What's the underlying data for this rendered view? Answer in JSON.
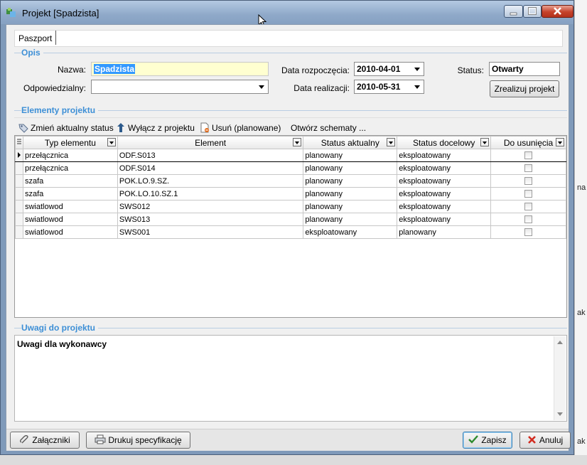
{
  "window": {
    "title": "Projekt [Spadzista]"
  },
  "tabs": [
    {
      "label": "Paszport"
    }
  ],
  "opis": {
    "section_label": "Opis",
    "nazwa_label": "Nazwa:",
    "nazwa_value": "Spadzista",
    "odpowiedzialny_label": "Odpowiedzialny:",
    "odpowiedzialny_value": "",
    "data_rozpoczecia_label": "Data rozpoczęcia:",
    "data_rozpoczecia_value": "2010-04-01",
    "data_realizacji_label": "Data realizacji:",
    "data_realizacji_value": "2010-05-31",
    "status_label": "Status:",
    "status_value": "Otwarty",
    "zrealizuj_button": "Zrealizuj projekt"
  },
  "elementy": {
    "section_label": "Elementy projektu",
    "toolbar": {
      "zmien": "Zmień aktualny status",
      "wylacz": "Wyłącz z projektu",
      "usun": "Usuń (planowane)",
      "otworz": "Otwórz schematy ..."
    },
    "columns": [
      "Typ elementu",
      "Element",
      "Status aktualny",
      "Status docelowy",
      "Do usunięcia"
    ],
    "rows": [
      {
        "typ": "przełącznica",
        "element": "ODF.S013",
        "status_aktualny": "planowany",
        "status_docelowy": "eksploatowany",
        "do_usuniecia": false
      },
      {
        "typ": "przełącznica",
        "element": "ODF.S014",
        "status_aktualny": "planowany",
        "status_docelowy": "eksploatowany",
        "do_usuniecia": false
      },
      {
        "typ": "szafa",
        "element": "POK.LO.9.SZ.",
        "status_aktualny": "planowany",
        "status_docelowy": "eksploatowany",
        "do_usuniecia": false
      },
      {
        "typ": "szafa",
        "element": "POK.LO.10.SZ.1",
        "status_aktualny": "planowany",
        "status_docelowy": "eksploatowany",
        "do_usuniecia": false
      },
      {
        "typ": "swiatlowod",
        "element": "SWS012",
        "status_aktualny": "planowany",
        "status_docelowy": "eksploatowany",
        "do_usuniecia": false
      },
      {
        "typ": "swiatlowod",
        "element": "SWS013",
        "status_aktualny": "planowany",
        "status_docelowy": "eksploatowany",
        "do_usuniecia": false
      },
      {
        "typ": "swiatlowod",
        "element": "SWS001",
        "status_aktualny": "eksploatowany",
        "status_docelowy": "planowany",
        "do_usuniecia": false
      }
    ]
  },
  "uwagi": {
    "section_label": "Uwagi do projektu",
    "text": "Uwagi dla wykonawcy"
  },
  "footer": {
    "zalaczniki": "Załączniki",
    "drukuj": "Drukuj specyfikację",
    "zapisz": "Zapisz",
    "anuluj": "Anuluj"
  },
  "background_fragments": [
    "na",
    "ak",
    "ak"
  ],
  "colors": {
    "section_label": "#3d8fd6",
    "selection": "#3399ff",
    "name_field_bg": "#ffffd0",
    "close_button": "#c5412a"
  }
}
